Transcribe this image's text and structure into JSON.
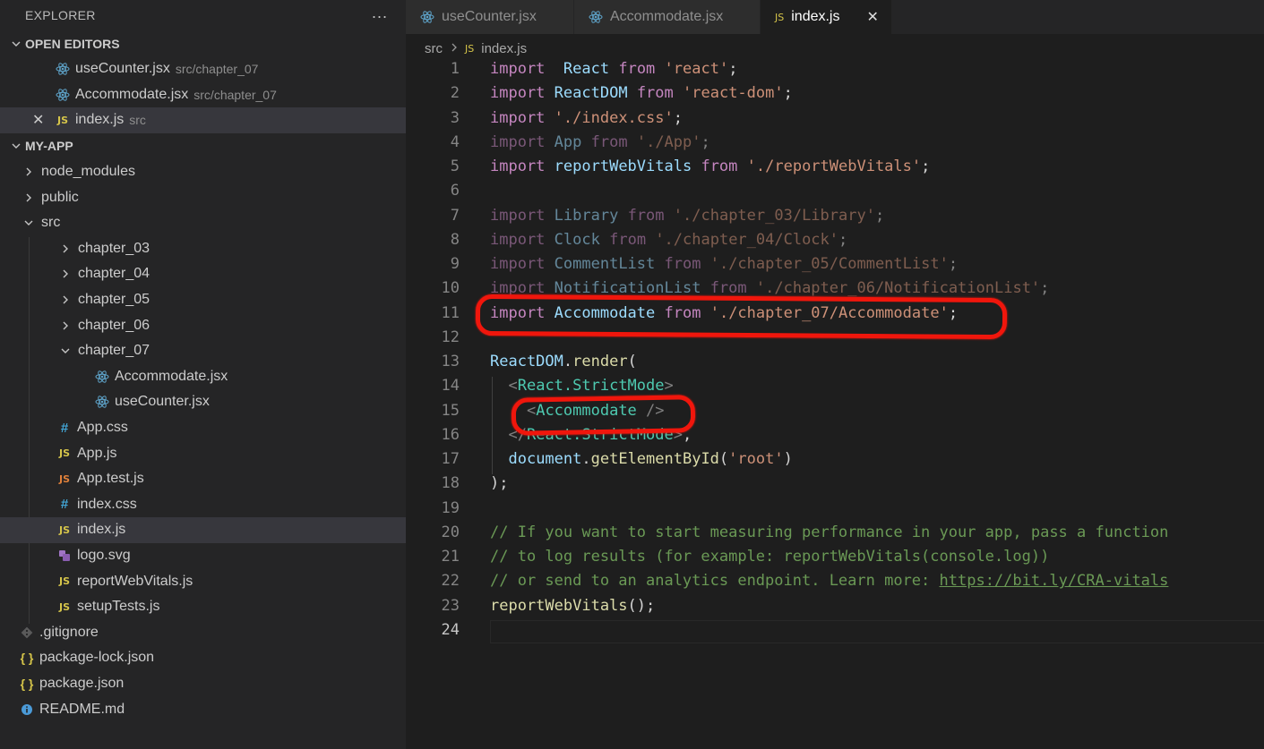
{
  "sidebar": {
    "title": "EXPLORER",
    "more_icon": "...",
    "open_editors": {
      "header": "OPEN EDITORS",
      "items": [
        {
          "name": "useCounter.jsx",
          "desc": "src/chapter_07",
          "icon": "react-icon"
        },
        {
          "name": "Accommodate.jsx",
          "desc": "src/chapter_07",
          "icon": "react-icon"
        },
        {
          "name": "index.js",
          "desc": "src",
          "icon": "js-icon"
        }
      ]
    },
    "project": {
      "header": "MY-APP",
      "items": [
        {
          "name": "node_modules"
        },
        {
          "name": "public"
        },
        {
          "name": "src"
        },
        {
          "name": "chapter_03"
        },
        {
          "name": "chapter_04"
        },
        {
          "name": "chapter_05"
        },
        {
          "name": "chapter_06"
        },
        {
          "name": "chapter_07"
        },
        {
          "name": "Accommodate.jsx"
        },
        {
          "name": "useCounter.jsx"
        },
        {
          "name": "App.css"
        },
        {
          "name": "App.js"
        },
        {
          "name": "App.test.js"
        },
        {
          "name": "index.css"
        },
        {
          "name": "index.js"
        },
        {
          "name": "logo.svg"
        },
        {
          "name": "reportWebVitals.js"
        },
        {
          "name": "setupTests.js"
        },
        {
          "name": ".gitignore"
        },
        {
          "name": "package-lock.json"
        },
        {
          "name": "package.json"
        },
        {
          "name": "README.md"
        }
      ]
    }
  },
  "tabs": [
    {
      "label": "useCounter.jsx"
    },
    {
      "label": "Accommodate.jsx"
    },
    {
      "label": "index.js"
    }
  ],
  "icon_glyphs": {
    "js": "JS",
    "css": "#",
    "json": "{ }",
    "close": "✕"
  },
  "breadcrumb": {
    "folder": "src",
    "file": "index.js"
  },
  "editor": {
    "current_line": 24,
    "lines": [
      {
        "n": "1",
        "tokens": [
          [
            "kw",
            "import"
          ],
          [
            "",
            "  "
          ],
          [
            "vr",
            "React"
          ],
          [
            "",
            " "
          ],
          [
            "kw",
            "from"
          ],
          [
            "",
            " "
          ],
          [
            "st",
            "'react'"
          ],
          [
            "",
            ";"
          ]
        ]
      },
      {
        "n": "2",
        "tokens": [
          [
            "kw",
            "import"
          ],
          [
            "",
            " "
          ],
          [
            "vr",
            "ReactDOM"
          ],
          [
            "",
            " "
          ],
          [
            "kw",
            "from"
          ],
          [
            "",
            " "
          ],
          [
            "st",
            "'react-dom'"
          ],
          [
            "",
            ";"
          ]
        ]
      },
      {
        "n": "3",
        "tokens": [
          [
            "kw",
            "import"
          ],
          [
            "",
            " "
          ],
          [
            "st",
            "'./index.css'"
          ],
          [
            "",
            ";"
          ]
        ]
      },
      {
        "n": "4",
        "dim": true,
        "tokens": [
          [
            "kw",
            "import"
          ],
          [
            "",
            " "
          ],
          [
            "vr",
            "App"
          ],
          [
            "",
            " "
          ],
          [
            "kw",
            "from"
          ],
          [
            "",
            " "
          ],
          [
            "st",
            "'./App'"
          ],
          [
            "",
            ";"
          ]
        ]
      },
      {
        "n": "5",
        "tokens": [
          [
            "kw",
            "import"
          ],
          [
            "",
            " "
          ],
          [
            "vr",
            "reportWebVitals"
          ],
          [
            "",
            " "
          ],
          [
            "kw",
            "from"
          ],
          [
            "",
            " "
          ],
          [
            "st",
            "'./reportWebVitals'"
          ],
          [
            "",
            ";"
          ]
        ]
      },
      {
        "n": "6",
        "tokens": []
      },
      {
        "n": "7",
        "dim": true,
        "tokens": [
          [
            "kw",
            "import"
          ],
          [
            "",
            " "
          ],
          [
            "vr",
            "Library"
          ],
          [
            "",
            " "
          ],
          [
            "kw",
            "from"
          ],
          [
            "",
            " "
          ],
          [
            "st",
            "'./chapter_03/Library'"
          ],
          [
            "",
            ";"
          ]
        ]
      },
      {
        "n": "8",
        "dim": true,
        "tokens": [
          [
            "kw",
            "import"
          ],
          [
            "",
            " "
          ],
          [
            "vr",
            "Clock"
          ],
          [
            "",
            " "
          ],
          [
            "kw",
            "from"
          ],
          [
            "",
            " "
          ],
          [
            "st",
            "'./chapter_04/Clock'"
          ],
          [
            "",
            ";"
          ]
        ]
      },
      {
        "n": "9",
        "dim": true,
        "tokens": [
          [
            "kw",
            "import"
          ],
          [
            "",
            " "
          ],
          [
            "vr",
            "CommentList"
          ],
          [
            "",
            " "
          ],
          [
            "kw",
            "from"
          ],
          [
            "",
            " "
          ],
          [
            "st",
            "'./chapter_05/CommentList'"
          ],
          [
            "",
            ";"
          ]
        ]
      },
      {
        "n": "10",
        "dim": true,
        "tokens": [
          [
            "kw",
            "import"
          ],
          [
            "",
            " "
          ],
          [
            "vr",
            "NotificationList"
          ],
          [
            "",
            " "
          ],
          [
            "kw",
            "from"
          ],
          [
            "",
            " "
          ],
          [
            "st",
            "'./chapter_06/NotificationList'"
          ],
          [
            "",
            ";"
          ]
        ]
      },
      {
        "n": "11",
        "tokens": [
          [
            "kw",
            "import"
          ],
          [
            "",
            " "
          ],
          [
            "vr",
            "Accommodate"
          ],
          [
            "",
            " "
          ],
          [
            "kw",
            "from"
          ],
          [
            "",
            " "
          ],
          [
            "st",
            "'./chapter_07/Accommodate'"
          ],
          [
            "",
            ";"
          ]
        ]
      },
      {
        "n": "12",
        "tokens": []
      },
      {
        "n": "13",
        "tokens": [
          [
            "vr",
            "ReactDOM"
          ],
          [
            "",
            "."
          ],
          [
            "fn",
            "render"
          ],
          [
            "",
            "("
          ]
        ]
      },
      {
        "n": "14",
        "tokens": [
          [
            "",
            "  "
          ],
          [
            "br",
            "<"
          ],
          [
            "tg",
            "React.StrictMode"
          ],
          [
            "br",
            ">"
          ]
        ]
      },
      {
        "n": "15",
        "tokens": [
          [
            "",
            "    "
          ],
          [
            "br",
            "<"
          ],
          [
            "tg",
            "Accommodate"
          ],
          [
            "",
            " "
          ],
          [
            "br",
            "/>"
          ]
        ]
      },
      {
        "n": "16",
        "tokens": [
          [
            "",
            "  "
          ],
          [
            "br",
            "</"
          ],
          [
            "tg",
            "React.StrictMode"
          ],
          [
            "br",
            ">"
          ],
          [
            "",
            ","
          ]
        ]
      },
      {
        "n": "17",
        "tokens": [
          [
            "",
            "  "
          ],
          [
            "vr",
            "document"
          ],
          [
            "",
            "."
          ],
          [
            "fn",
            "getElementById"
          ],
          [
            "",
            "("
          ],
          [
            "st",
            "'root'"
          ],
          [
            "",
            ")"
          ]
        ]
      },
      {
        "n": "18",
        "tokens": [
          [
            "",
            ");"
          ]
        ]
      },
      {
        "n": "19",
        "tokens": []
      },
      {
        "n": "20",
        "tokens": [
          [
            "cm",
            "// If you want to start measuring performance in your app, pass a function"
          ]
        ]
      },
      {
        "n": "21",
        "tokens": [
          [
            "cm",
            "// to log results (for example: reportWebVitals(console.log))"
          ]
        ]
      },
      {
        "n": "22",
        "tokens": [
          [
            "cm",
            "// or send to an analytics endpoint. Learn more: "
          ],
          [
            "lk",
            "https://bit.ly/CRA-vitals"
          ]
        ]
      },
      {
        "n": "23",
        "tokens": [
          [
            "fn",
            "reportWebVitals"
          ],
          [
            "",
            "();"
          ]
        ]
      },
      {
        "n": "24",
        "tokens": []
      }
    ]
  },
  "colors": {
    "marker": "#f0160c",
    "keyword": "#c586c0",
    "variable": "#9cdcfe",
    "string": "#ce9178",
    "function": "#dcdcaa",
    "tag": "#4ec9b0",
    "comment": "#6a9955"
  }
}
